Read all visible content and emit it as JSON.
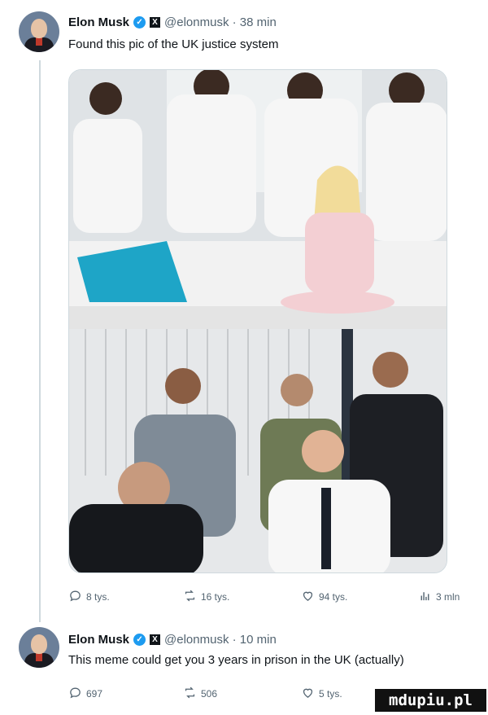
{
  "posts": [
    {
      "name": "Elon Musk",
      "handle": "@elonmusk · 38 min",
      "text": "Found this pic of the UK justice system",
      "actions": {
        "replies": "8 tys.",
        "reposts": "16 tys.",
        "likes": "94 tys.",
        "views": "3 mln"
      }
    },
    {
      "name": "Elon Musk",
      "handle": "@elonmusk · 10 min",
      "text": "This meme could get you 3 years in prison in the UK (actually)",
      "actions": {
        "replies": "697",
        "reposts": "506",
        "likes": "5 tys."
      }
    }
  ],
  "badges": {
    "verified": "✓",
    "platform": "X"
  },
  "watermark": "mdupiu.pl",
  "colors": {
    "verified": "#1d9bf0",
    "muted": "#536471",
    "text": "#0f1419"
  },
  "icons": [
    "reply-icon",
    "repost-icon",
    "like-icon",
    "views-icon",
    "verified-icon",
    "x-logo-icon"
  ]
}
